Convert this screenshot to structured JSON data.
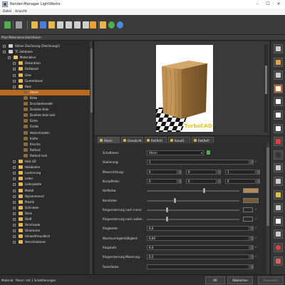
{
  "window": {
    "title": "Render-Manager LightWorks",
    "controls": {
      "minimize": "–",
      "maximize": "☐",
      "close": "✕"
    }
  },
  "menu": {
    "items": [
      "Datei",
      "Ansicht"
    ]
  },
  "toolbar": {
    "buttons": [
      {
        "name": "back-icon",
        "color": "#4caf50"
      },
      {
        "name": "forward-icon",
        "color": "#9e9e9e"
      },
      {
        "name": "new-folder-icon",
        "color": "#e8b64a"
      },
      {
        "name": "new-material-icon",
        "color": "#4a7ed8"
      },
      {
        "name": "open-folder-icon",
        "color": "#e8b64a"
      },
      {
        "name": "copy-icon",
        "color": "#d0d0d0"
      },
      {
        "name": "search-icon",
        "color": "#d0d0d0"
      },
      {
        "name": "edit-icon",
        "color": "#d0d0d0"
      },
      {
        "name": "delete-icon",
        "color": "#d0d0d0"
      },
      {
        "name": "gear-icon",
        "color": "#f0a030"
      },
      {
        "name": "folder-settings-icon",
        "color": "#e8b64a"
      },
      {
        "name": "render-icon",
        "color": "#4caf50"
      },
      {
        "name": "help-icon",
        "color": "#4a8ad8"
      }
    ]
  },
  "path": {
    "text": "Pfad Materialien\\Holz\\Ahorn"
  },
  "tree": {
    "items": [
      {
        "label": "Aktive Zeichnung (Zeichnung1)",
        "depth": 0,
        "icon": "doc",
        "expanded": false
      },
      {
        "label": "TC database",
        "depth": 0,
        "icon": "doc",
        "expanded": true
      },
      {
        "label": "Materialien",
        "depth": 1,
        "icon": "folder-open",
        "expanded": true
      },
      {
        "label": "Dekoration",
        "depth": 2,
        "icon": "folder"
      },
      {
        "label": "Farbband",
        "depth": 2,
        "icon": "folder"
      },
      {
        "label": "Glas",
        "depth": 2,
        "icon": "folder"
      },
      {
        "label": "Gummiband",
        "depth": 2,
        "icon": "folder"
      },
      {
        "label": "Holz",
        "depth": 2,
        "icon": "folder-open",
        "expanded": true
      },
      {
        "label": "Ahorn",
        "depth": 3,
        "icon": "material",
        "selected": true
      },
      {
        "label": "Birke",
        "depth": 3,
        "icon": "material"
      },
      {
        "label": "Druckbehandelt",
        "depth": 3,
        "icon": "material"
      },
      {
        "label": "Dunkles Holz",
        "depth": 3,
        "icon": "material"
      },
      {
        "label": "Dunkles Holz lack",
        "depth": 3,
        "icon": "material"
      },
      {
        "label": "Eiche",
        "depth": 3,
        "icon": "material"
      },
      {
        "label": "Fichte",
        "depth": 3,
        "icon": "material"
      },
      {
        "label": "Holzschindeln",
        "depth": 3,
        "icon": "material"
      },
      {
        "label": "Kiefer",
        "depth": 3,
        "icon": "material"
      },
      {
        "label": "Kirsche",
        "depth": 3,
        "icon": "material"
      },
      {
        "label": "Rotholz",
        "depth": 3,
        "icon": "material"
      },
      {
        "label": "Rotholz lack",
        "depth": 3,
        "icon": "material"
      },
      {
        "label": "Holz 2D",
        "depth": 2,
        "icon": "folder"
      },
      {
        "label": "Holzboden",
        "depth": 2,
        "icon": "folder"
      },
      {
        "label": "Lackierung",
        "depth": 2,
        "icon": "folder"
      },
      {
        "label": "Leder",
        "depth": 2,
        "icon": "folder"
      },
      {
        "label": "Leiterplatte",
        "depth": 2,
        "icon": "folder"
      },
      {
        "label": "Metall",
        "depth": 2,
        "icon": "folder"
      },
      {
        "label": "Ogrammrend",
        "depth": 2,
        "icon": "folder"
      },
      {
        "label": "Plastik",
        "depth": 2,
        "icon": "folder"
      },
      {
        "label": "Schindeln",
        "depth": 2,
        "icon": "folder"
      },
      {
        "label": "Stein",
        "depth": 2,
        "icon": "folder"
      },
      {
        "label": "Stoff",
        "depth": 2,
        "icon": "folder"
      },
      {
        "label": "Strichcode",
        "depth": 2,
        "icon": "folder"
      },
      {
        "label": "Strukturen",
        "depth": 2,
        "icon": "folder"
      },
      {
        "label": "Umweltfreundlich",
        "depth": 2,
        "icon": "folder"
      },
      {
        "label": "Verschiedenes",
        "depth": 2,
        "icon": "folder"
      }
    ]
  },
  "preview": {
    "watermark": "TurboCAD"
  },
  "tabs": [
    {
      "label": "Ahorn",
      "active": true
    },
    {
      "label": "Glanzlicht",
      "active": false
    },
    {
      "label": "Rel(Ref)",
      "active": false
    },
    {
      "label": "Kanal1",
      "active": false
    },
    {
      "label": "Rel(Ref)",
      "active": false
    }
  ],
  "props": {
    "rows": [
      {
        "label": "Schattierer:",
        "kind": "dropdown",
        "value": "Ahorn",
        "green": true
      },
      {
        "label": "Skalierung:",
        "kind": "field",
        "values": [
          "1"
        ],
        "check": true
      },
      {
        "label": "Maserrichtung:",
        "kind": "field3",
        "values": [
          "0",
          "0",
          "1"
        ]
      },
      {
        "label": "Kornpffeiler:",
        "kind": "field3",
        "values": [
          "0",
          "0",
          "0"
        ]
      },
      {
        "label": "Hellfarbe:",
        "kind": "sliderswatch",
        "level": 0.62,
        "color": "#b58a55"
      },
      {
        "label": "Kernfarbe:",
        "kind": "sliderswatch",
        "level": 0.3,
        "color": "#7a5a32"
      },
      {
        "label": "Ringverzerrung nach innen:",
        "kind": "slidercheck",
        "level": 0.22
      },
      {
        "label": "Ringverzerrung nach außen:",
        "kind": "slidercheck",
        "level": 0.22
      },
      {
        "label": "Ringbreite:",
        "kind": "field",
        "values": [
          "0,4"
        ],
        "check": true
      },
      {
        "label": "Wuchsunregelmäßigkeit:",
        "kind": "field",
        "values": [
          "0,04"
        ],
        "check": true
      },
      {
        "label": "Ringstufe:",
        "kind": "field",
        "values": [
          "0,4"
        ],
        "check": true
      },
      {
        "label": "Ringverzerrung Maserung:",
        "kind": "field",
        "values": [
          "0,2"
        ],
        "check": true
      },
      {
        "label": "Fasenfarbe:",
        "kind": "field",
        "values": [
          ""
        ],
        "check": false
      }
    ]
  },
  "rightTools": [
    {
      "name": "pin-icon"
    },
    {
      "name": "compass-icon"
    },
    {
      "name": "plate-icon"
    },
    {
      "name": "material-editor-icon",
      "highlight": true
    },
    {
      "name": "pointer-icon"
    },
    {
      "name": "pointer-alt-icon"
    },
    {
      "name": "x-tool-icon"
    },
    {
      "name": "red-tool-icon"
    },
    {
      "name": "dark-sphere-icon"
    },
    {
      "name": "image-icon"
    },
    {
      "name": "stripes-icon"
    },
    {
      "name": "lamp-icon"
    },
    {
      "name": "tools-icon"
    },
    {
      "name": "x-tool2-icon"
    },
    {
      "name": "brush-icon"
    },
    {
      "name": "record-icon"
    },
    {
      "name": "highlight-icon"
    }
  ],
  "status": {
    "text": "Material: 'Ahorn' mit 1 Schattierungen",
    "ok": "OK",
    "cancel": "Abbrechen",
    "apply": "Anwenden"
  }
}
